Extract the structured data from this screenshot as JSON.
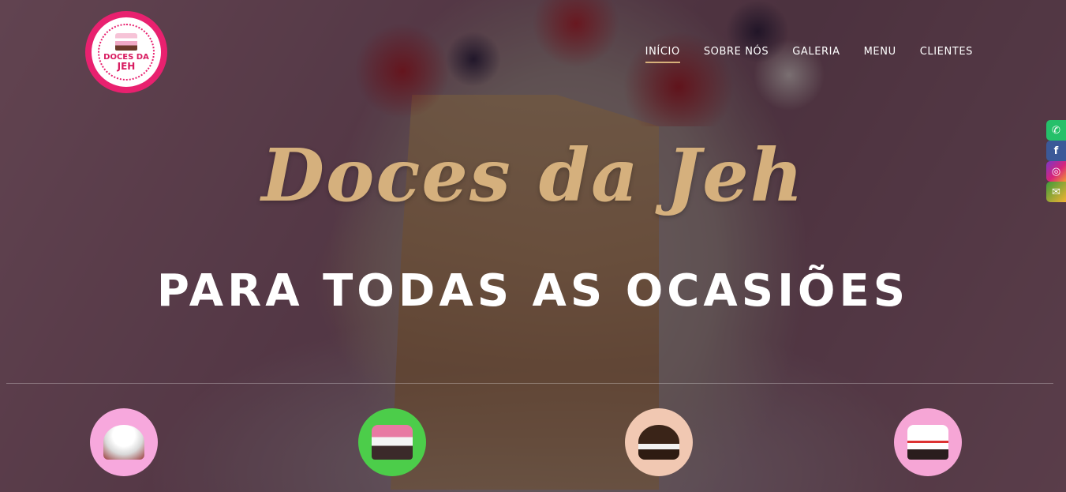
{
  "brand": {
    "logo_line1": "DOCES DA",
    "logo_line2": "JEH"
  },
  "nav": {
    "items": [
      {
        "label": "INÍCIO",
        "active": true
      },
      {
        "label": "SOBRE NÓS",
        "active": false
      },
      {
        "label": "GALERIA",
        "active": false
      },
      {
        "label": "MENU",
        "active": false
      },
      {
        "label": "CLIENTES",
        "active": false
      }
    ]
  },
  "hero": {
    "title": "Doces da Jeh",
    "subtitle": "PARA TODAS AS OCASIÕES"
  },
  "social": {
    "items": [
      {
        "name": "whatsapp-icon",
        "glyph": "✆"
      },
      {
        "name": "facebook-icon",
        "glyph": "f"
      },
      {
        "name": "instagram-icon",
        "glyph": "◎"
      },
      {
        "name": "email-icon",
        "glyph": "✉"
      }
    ]
  },
  "colors": {
    "accent_gold": "#d5b07d",
    "brand_pink": "#e8216f",
    "text_white": "#ffffff"
  },
  "thumbnails": [
    {
      "name": "cake-thumb-1",
      "bg": "#f7a8dd"
    },
    {
      "name": "cake-thumb-2",
      "bg": "#4ccd4a"
    },
    {
      "name": "cake-thumb-3",
      "bg": "#f1c8b2"
    },
    {
      "name": "cake-thumb-4",
      "bg": "#f6a6d6"
    }
  ]
}
